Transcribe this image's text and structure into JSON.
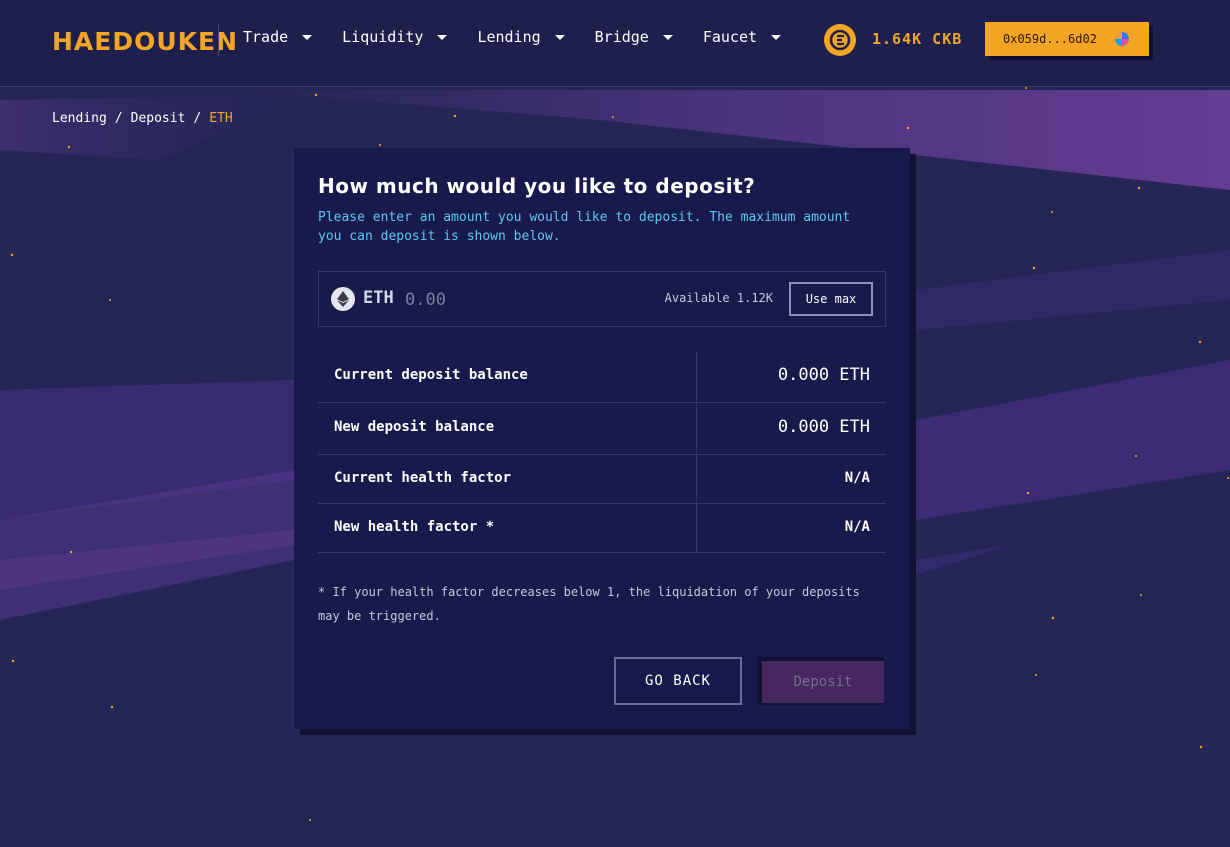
{
  "colors": {
    "accent": "#f5a524",
    "background": "#252556",
    "card": "#171a4a",
    "subtitle": "#5ec8f2",
    "deposit_disabled": "#45285f"
  },
  "header": {
    "logo_text": "HAEDOUKEN",
    "nav": [
      {
        "label": "Trade",
        "icon": "chevron-down-icon"
      },
      {
        "label": "Liquidity",
        "icon": "chevron-down-icon"
      },
      {
        "label": "Lending",
        "icon": "chevron-down-icon"
      },
      {
        "label": "Bridge",
        "icon": "chevron-down-icon"
      },
      {
        "label": "Faucet",
        "icon": "chevron-down-icon"
      }
    ],
    "ckb_icon": "ckb-token-icon",
    "ckb_balance": "1.64K CKB",
    "wallet_address": "0x059d...6d02",
    "wallet_avatar_icon": "wallet-avatar-icon"
  },
  "breadcrumb": {
    "items": [
      "Lending",
      "Deposit"
    ],
    "separator": "/",
    "current": "ETH"
  },
  "card": {
    "title": "How much would you like to deposit?",
    "subtitle": "Please enter an amount you would like to deposit. The maximum amount you can deposit is shown below.",
    "amount": {
      "token_icon": "ethereum-icon",
      "token_symbol": "ETH",
      "value": "",
      "placeholder": "0.00",
      "available": "Available 1.12K",
      "use_max_label": "Use max"
    },
    "stats": [
      {
        "label": "Current deposit balance",
        "value": "0.000 ETH"
      },
      {
        "label": "New deposit balance",
        "value": "0.000 ETH"
      },
      {
        "label": "Current health factor",
        "value": "N/A"
      },
      {
        "label": "New health factor *",
        "value": "N/A"
      }
    ],
    "footnote": "* If your health factor decreases below 1, the liquidation of your deposits may be triggered.",
    "go_back_label": "GO BACK",
    "deposit_label": "Deposit"
  }
}
